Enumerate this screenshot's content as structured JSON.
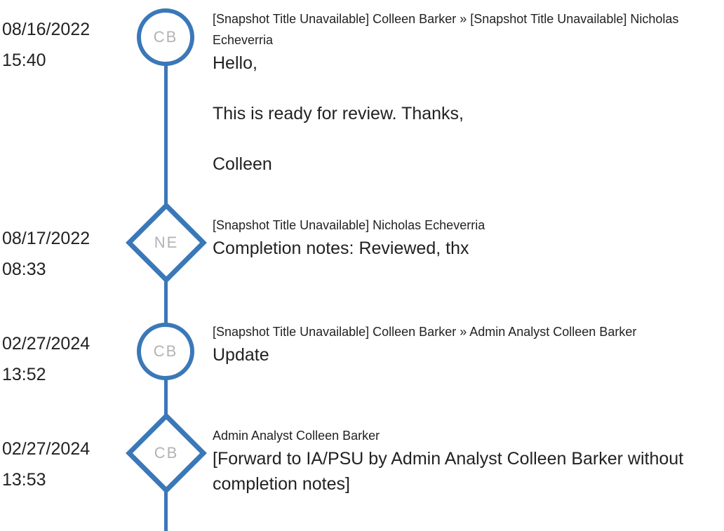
{
  "accent_color": "#3a78b8",
  "events": [
    {
      "date": "08/16/2022",
      "time": "15:40",
      "marker_shape": "circle",
      "initials": "CB",
      "header": "[Snapshot Title Unavailable] Colleen Barker » [Snapshot Title Unavailable] Nicholas Echeverria",
      "body": "Hello,\n\nThis is ready for review.  Thanks,\n\nColleen"
    },
    {
      "date": "08/17/2022",
      "time": "08:33",
      "marker_shape": "diamond",
      "initials": "NE",
      "header": "[Snapshot Title Unavailable] Nicholas Echeverria",
      "body": "Completion notes: Reviewed, thx"
    },
    {
      "date": "02/27/2024",
      "time": "13:52",
      "marker_shape": "circle",
      "initials": "CB",
      "header": "[Snapshot Title Unavailable] Colleen Barker » Admin Analyst Colleen Barker",
      "body": "Update"
    },
    {
      "date": "02/27/2024",
      "time": "13:53",
      "marker_shape": "diamond",
      "initials": "CB",
      "header": "Admin Analyst Colleen Barker",
      "body": "[Forward to IA/PSU by Admin Analyst Colleen Barker without completion notes]"
    }
  ]
}
